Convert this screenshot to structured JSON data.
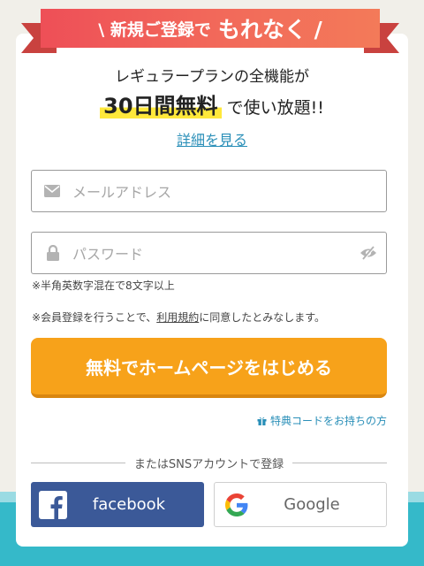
{
  "ribbon": {
    "lead": "\\ 新規ご登録で",
    "emph": "もれなく /"
  },
  "headline": {
    "line1": "レギュラープランの全機能が",
    "big": "30日間無料",
    "rest": " で使い放題!!"
  },
  "details_link": "詳細を見る",
  "email": {
    "placeholder": "メールアドレス",
    "icon": "envelope-icon"
  },
  "password": {
    "placeholder": "パスワード",
    "icon": "lock-icon",
    "toggle_icon": "eye-slash-icon"
  },
  "password_note": "※半角英数字混在で8文字以上",
  "terms": {
    "before": "※会員登録を行うことで、",
    "link": "利用規約",
    "after": "に同意したとみなします。"
  },
  "cta_label": "無料でホームページをはじめる",
  "coupon_link": "特典コードをお持ちの方",
  "divider_text": "またはSNSアカウントで登録",
  "facebook_label": "facebook",
  "google_label": "Google",
  "colors": {
    "ribbon": "#ee4f57",
    "cta": "#f7a21a",
    "link": "#2a8fb8",
    "facebook": "#3b5998",
    "highlight": "#ffe83b",
    "footer": "#35b9c9"
  }
}
